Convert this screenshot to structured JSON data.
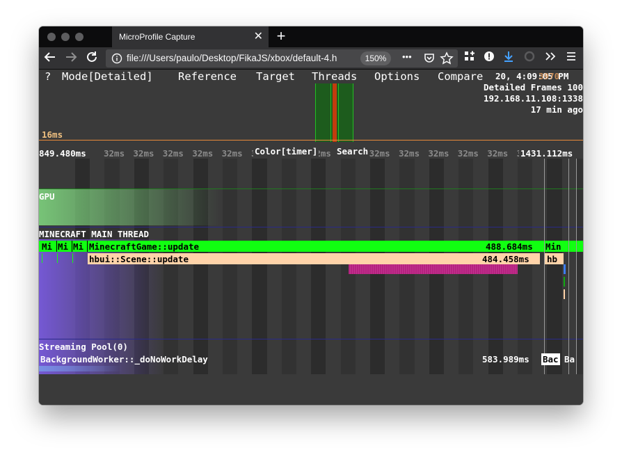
{
  "browser": {
    "tab_title": "MicroProfile Capture",
    "tab_close": "✕",
    "new_tab": "+",
    "url": "file:///Users/paulo/Desktop/FikaJS/xbox/default-4.h",
    "zoom": "150%",
    "page_actions": "•••",
    "icons": [
      "back-arrow-icon",
      "forward-arrow-icon",
      "reload-icon",
      "info-icon",
      "pocket-icon",
      "bookmark-star-icon",
      "library-icon",
      "account-icon",
      "downloads-icon",
      "sync-icon",
      "overflow-chevron-icon",
      "hamburger-menu-icon"
    ]
  },
  "profiler": {
    "menu": {
      "help": "?",
      "mode": "Mode[Detailed]",
      "reference": "Reference",
      "target": "Target",
      "threads": "Threads",
      "options": "Options",
      "compare": "Compare"
    },
    "info": {
      "date_line": "20, 4:09:05 PM",
      "overlap_text": "3970",
      "detailed_frames": "Detailed Frames 100",
      "address": "192.168.11.108:1338",
      "age": "17 min ago"
    },
    "frame_graph": {
      "ref_label": "16ms",
      "colors": {
        "reference_line": "#e8893a",
        "selection": "#22c122",
        "highlight": "#c23c0e"
      }
    },
    "timeline": {
      "start": "849.480ms",
      "end": "1431.112ms",
      "tick_label": "32ms",
      "tick_count": 15,
      "color_mode": "Color[timer]",
      "search": "Search"
    },
    "threads": [
      {
        "name": "GPU",
        "color": "#1f7a1f"
      },
      {
        "name": "MINECRAFT MAIN THREAD",
        "color": "#2a2a8a"
      },
      {
        "name": "Streaming Pool(0)",
        "color": "#2a2a8a"
      }
    ],
    "main_thread_bars": {
      "small_labels": [
        "Mi",
        "Mi",
        "Mi"
      ],
      "game_update": {
        "name": "MinecraftGame::update",
        "time": "488.684ms",
        "color": "#11ff11"
      },
      "game_update_tail": "Min",
      "scene_update": {
        "name": "hbui::Scene::update",
        "time": "484.458ms",
        "color": "#ffd3a9"
      },
      "scene_tail": "hb",
      "child_color": "#b5227f"
    },
    "streaming_bars": {
      "worker": {
        "name": "BackgroundWorker::_doNoWorkDelay",
        "time": "583.989ms"
      },
      "tail1": "Bac",
      "tail2": "Ba"
    }
  }
}
